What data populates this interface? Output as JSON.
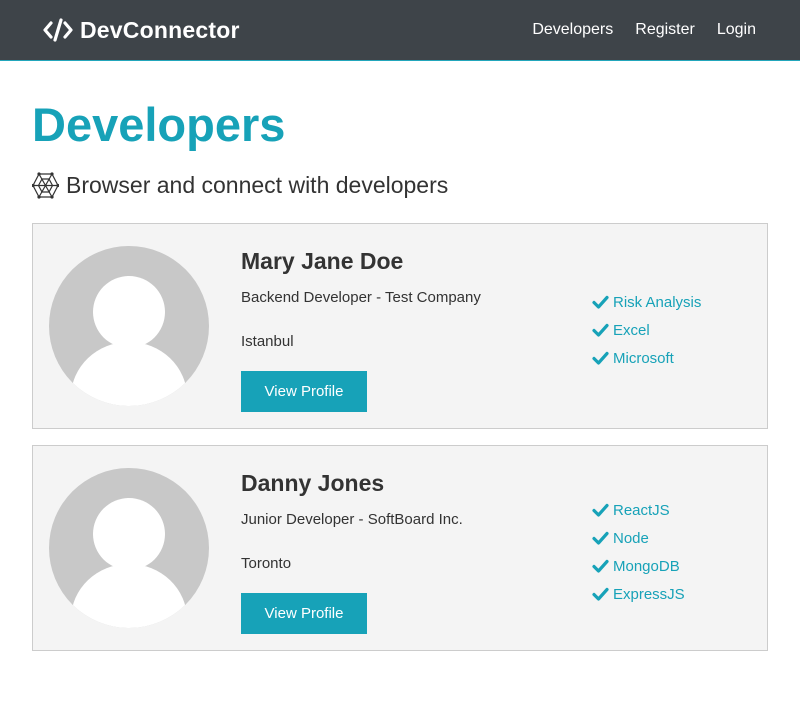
{
  "nav": {
    "brand": "DevConnector",
    "links": [
      "Developers",
      "Register",
      "Login"
    ]
  },
  "page": {
    "title": "Developers",
    "lead": "Browser and connect with developers"
  },
  "profiles": [
    {
      "name": "Mary Jane Doe",
      "status": "Backend Developer - Test Company",
      "location": "Istanbul",
      "button": "View Profile",
      "skills": [
        "Risk Analysis",
        "Excel",
        "Microsoft"
      ]
    },
    {
      "name": "Danny Jones",
      "status": "Junior Developer - SoftBoard Inc.",
      "location": "Toronto",
      "button": "View Profile",
      "skills": [
        "ReactJS",
        "Node",
        "MongoDB",
        "ExpressJS"
      ]
    }
  ],
  "colors": {
    "primary": "#17a2b8",
    "navbar": "#343a40",
    "card_bg": "#f4f4f4",
    "avatar": "#c8c8c8"
  },
  "icons": {
    "brand": "code-icon",
    "lead": "connect-develop-icon",
    "skill": "check-icon"
  }
}
